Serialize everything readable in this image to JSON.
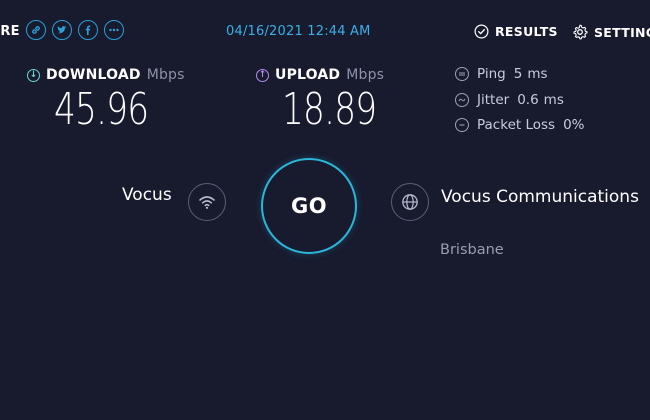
{
  "header": {
    "share_label": "ARE",
    "share_icons": [
      "link-icon",
      "twitter-icon",
      "facebook-icon",
      "more-icon"
    ],
    "datetime": "04/16/2021 12:44 AM",
    "results_label": "RESULTS",
    "settings_label": "SETTING"
  },
  "download": {
    "label": "DOWNLOAD",
    "unit": "Mbps",
    "value": "45.96"
  },
  "upload": {
    "label": "UPLOAD",
    "unit": "Mbps",
    "value": "18.89"
  },
  "stats": {
    "ping": {
      "label": "Ping",
      "value": "5",
      "unit": "ms"
    },
    "jitter": {
      "label": "Jitter",
      "value": "0.6",
      "unit": "ms"
    },
    "packet_loss": {
      "label": "Packet Loss",
      "value": "0%"
    }
  },
  "go_label": "GO",
  "isp": {
    "name": "Vocus"
  },
  "server": {
    "name": "Vocus Communications",
    "location": "Brisbane"
  },
  "colors": {
    "background": "#181a2e",
    "accent": "#2bb6d9",
    "download": "#6ad6cf",
    "upload": "#b18cf0"
  }
}
